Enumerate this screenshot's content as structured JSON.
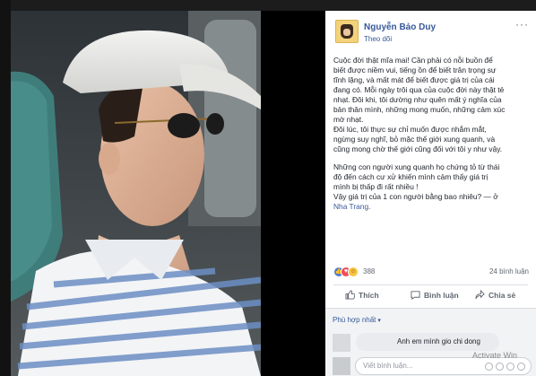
{
  "post": {
    "author": "Nguyễn Bảo Duy",
    "follow_label": "Theo dõi",
    "more": "···",
    "paragraphs": [
      [
        "Cuộc đời thật mĩa mai! Cần phải có nỗi buồn để",
        "biết được niềm vui, tiếng ồn để biết trân trọng sự",
        "tĩnh lặng, và mất mát để biết được giá trị của cái",
        "đang có. Mỗi ngày trôi qua của cuộc đời này thật tẻ",
        "nhạt. Đôi khi, tôi dường như quên mất ý nghĩa của",
        "bản thân mình, những mong muốn, những cảm xúc",
        "mờ nhạt."
      ],
      [
        "Đôi lúc, tôi thực sự chỉ muốn được nhắm mắt,",
        "ngừng suy nghĩ, bỏ mặc thế giới xung quanh, và",
        "cũng mong chờ thế giới cũng đối với tôi y như vậy."
      ],
      [
        "Những con người xung quanh họ chứng tỏ từ thái",
        "độ đến cách cư xử khiến mình cảm thấy giá trị",
        "mình bị thấp đi rất nhiều !",
        "Vậy giá trị của 1 con người bằng bao nhiêu? — ở"
      ]
    ],
    "location": "Nha Trang.",
    "reaction_count": "388",
    "comment_count": "24 bình luận",
    "actions": {
      "like": "Thích",
      "comment": "Bình luận",
      "share": "Chia sẻ"
    },
    "sort_label": "Phù hợp nhất",
    "comments": [
      {
        "text": "Anh em mình gio chi dong"
      }
    ],
    "write_placeholder": "Viết bình luận..."
  },
  "watermark": "Activate Win"
}
